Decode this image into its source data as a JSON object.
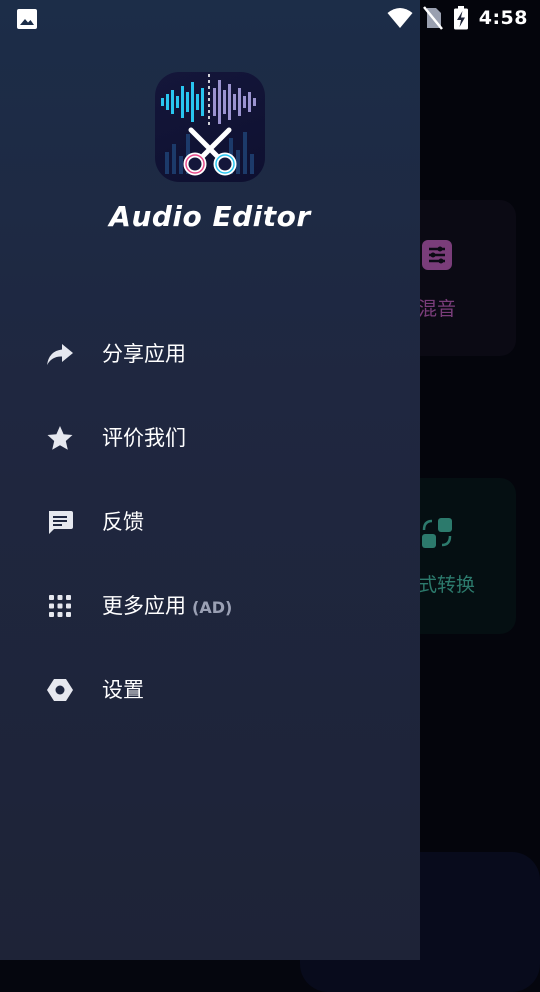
{
  "status_bar": {
    "time": "4:58",
    "icons": [
      "image-notification-icon",
      "wifi-icon",
      "no-sim-icon",
      "battery-charging-icon"
    ]
  },
  "drawer": {
    "app_name": "Audio Editor",
    "logo_icon": "scissors-waveform-logo",
    "menu": [
      {
        "label": "分享应用",
        "icon": "share-icon"
      },
      {
        "label": "评价我们",
        "icon": "star-icon"
      },
      {
        "label": "反馈",
        "icon": "feedback-icon"
      },
      {
        "label": "更多应用",
        "badge": "(AD)",
        "icon": "apps-grid-icon"
      },
      {
        "label": "设置",
        "icon": "settings-icon"
      }
    ]
  },
  "background": {
    "cards": [
      {
        "label": "混音",
        "icon": "mixer-icon"
      },
      {
        "label": "式转换",
        "icon": "format-convert-icon"
      }
    ]
  },
  "colors": {
    "drawer_top": "#1c2d48",
    "drawer_bottom": "#1e2337",
    "mix_accent": "#7a3d7a",
    "convert_accent": "#2c7a6c"
  }
}
